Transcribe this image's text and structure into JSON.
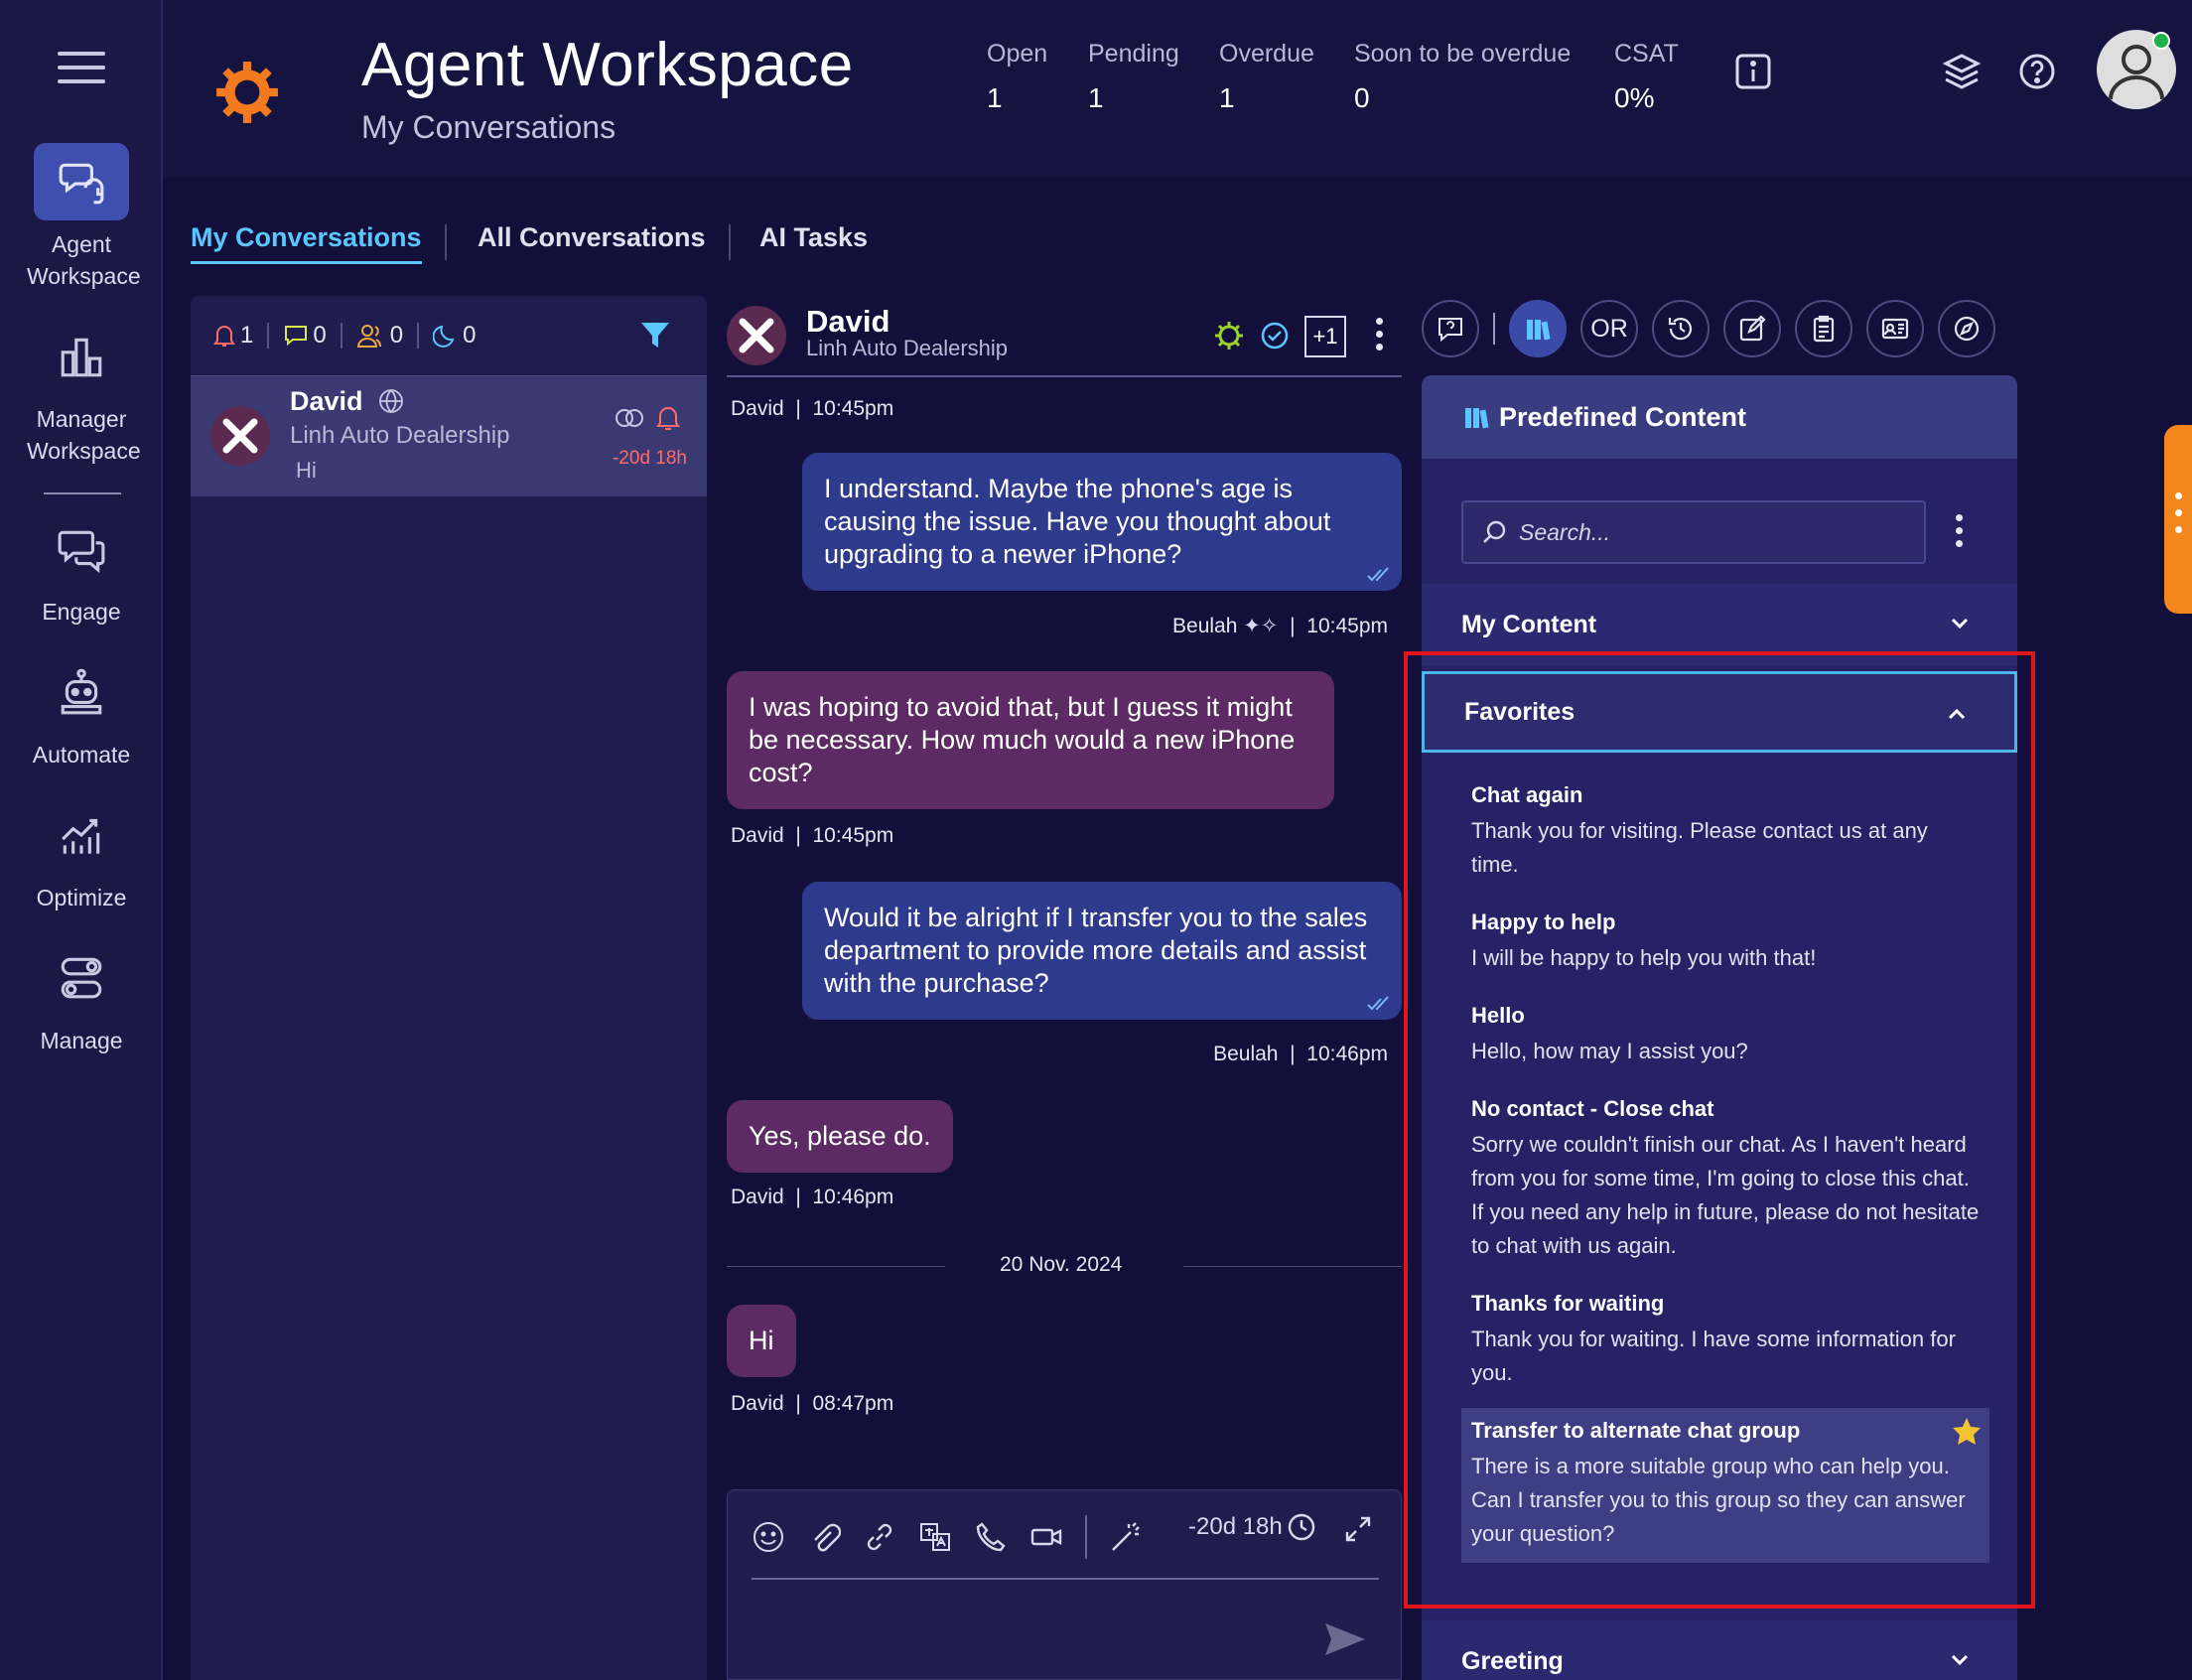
{
  "app": {
    "title": "Agent Workspace",
    "subtitle": "My Conversations"
  },
  "stats": [
    {
      "label": "Open",
      "value": "1"
    },
    {
      "label": "Pending",
      "value": "1"
    },
    {
      "label": "Overdue",
      "value": "1"
    },
    {
      "label": "Soon to be overdue",
      "value": "0"
    },
    {
      "label": "CSAT",
      "value": "0%"
    }
  ],
  "sidebar": {
    "items": [
      {
        "label": "Agent Workspace",
        "icon": "headset-chat-icon"
      },
      {
        "label": "Manager Workspace",
        "icon": "bar-chart-icon"
      },
      {
        "label": "Engage",
        "icon": "chat-bubbles-icon"
      },
      {
        "label": "Automate",
        "icon": "robot-icon"
      },
      {
        "label": "Optimize",
        "icon": "line-chart-icon"
      },
      {
        "label": "Manage",
        "icon": "toggles-icon"
      }
    ]
  },
  "tabs": [
    "My Conversations",
    "All Conversations",
    "AI Tasks"
  ],
  "filters": {
    "alerts": "1",
    "messages": "0",
    "users": "0",
    "sleep": "0"
  },
  "conversation": {
    "name": "David",
    "company": "Linh Auto Dealership",
    "preview": "Hi",
    "time": "-20d 18h"
  },
  "chat": {
    "header": {
      "name": "David",
      "company": "Linh Auto Dealership",
      "plus": "+1"
    },
    "top_meta": {
      "name": "David",
      "time": "10:45pm"
    },
    "messages": [
      {
        "from": "agent",
        "text": "I understand. Maybe the phone's age is causing the issue. Have you thought about upgrading to a newer iPhone?",
        "name": "Beulah",
        "time": "10:45pm"
      },
      {
        "from": "customer",
        "text": "I was hoping to avoid that, but I guess it might be necessary. How much would a new iPhone cost?",
        "name": "David",
        "time": "10:45pm"
      },
      {
        "from": "agent",
        "text": "Would it be alright if I transfer you to the sales department to provide more details and assist with the purchase?",
        "name": "Beulah",
        "time": "10:46pm"
      },
      {
        "from": "customer",
        "text": "Yes, please do.",
        "name": "David",
        "time": "10:46pm"
      },
      {
        "from": "customer",
        "text": "Hi",
        "name": "David",
        "time": "08:47pm"
      }
    ],
    "date_separator": "20 Nov. 2024",
    "compose_timer": "-20d 18h"
  },
  "right_panel": {
    "toolbar_or": "OR",
    "title": "Predefined Content",
    "search_placeholder": "Search...",
    "sections": {
      "my_content": "My Content",
      "favorites": "Favorites",
      "greeting": "Greeting"
    },
    "favorites": [
      {
        "title": "Chat again",
        "text": "Thank you for visiting. Please contact us at any time."
      },
      {
        "title": "Happy to help",
        "text": "I will be happy to help you with that!"
      },
      {
        "title": "Hello",
        "text": "Hello, how may I assist you?"
      },
      {
        "title": "No contact - Close chat",
        "text": "Sorry we couldn't finish our chat. As I haven't heard from you for some time, I'm going to close this chat. If you need any help in future, please do not hesitate to chat with us again."
      },
      {
        "title": "Thanks for waiting",
        "text": "Thank you for waiting. I have some information for you."
      },
      {
        "title": "Transfer to alternate chat group",
        "text": "There is a more suitable group who can help you. Can I transfer you to this group so they can answer your question?"
      }
    ]
  },
  "colors": {
    "accent": "#5cc6ff",
    "brand_orange": "#f47a20",
    "highlight_box": "#e0161c",
    "agent_bubble": "#2e3b8c",
    "customer_bubble": "#5c2b63"
  }
}
